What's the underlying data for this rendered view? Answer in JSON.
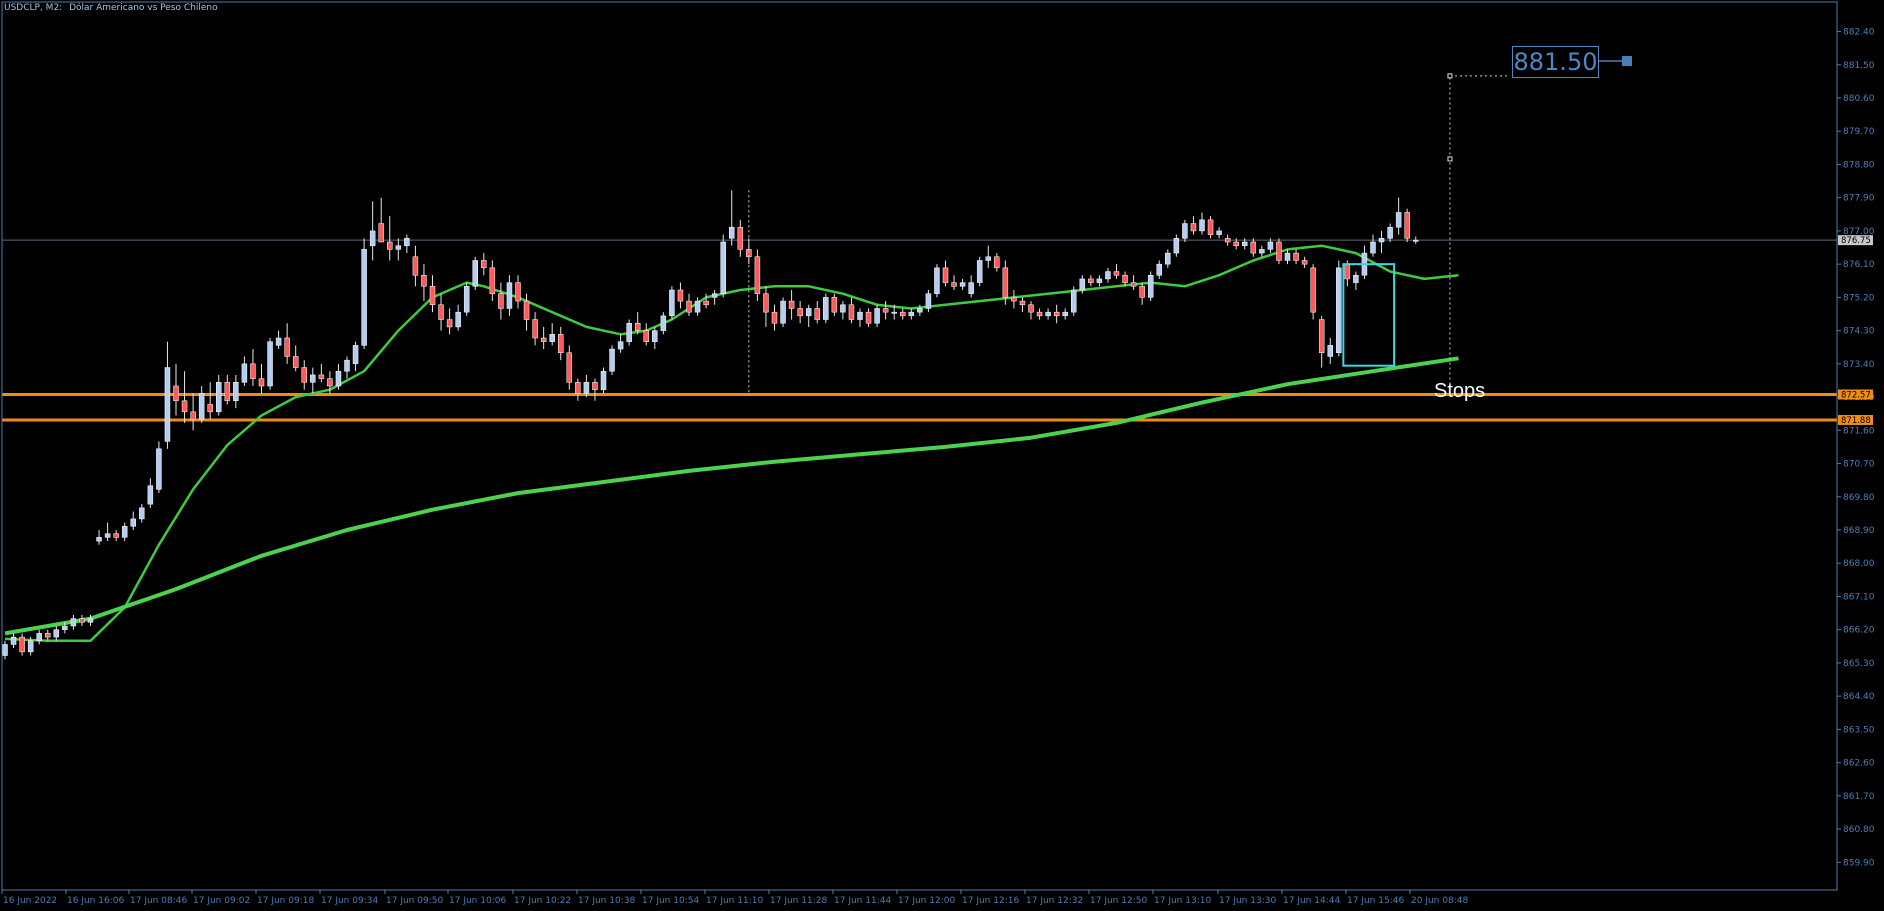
{
  "header": {
    "symbol": "USDCLP, M2:",
    "description": "Dólar Americano vs Peso Chileno"
  },
  "annotations": {
    "price_target": "881.50",
    "stops_label": "Stops"
  },
  "colors": {
    "background": "#000000",
    "axis": "#4a7db8",
    "axis_text": "#4a7db8",
    "bull_candle": "#b4cdf0",
    "bear_candle": "#ff5a5a",
    "ma_fast": "#3ecb3e",
    "ma_slow": "#4cd24c",
    "stops_line": "#f08c12",
    "box": "#3fd5e0",
    "current_price_line": "#5d6a78"
  },
  "chart_data": {
    "type": "candlestick",
    "symbol": "USDCLP",
    "timeframe": "M2",
    "ylim": [
      859.15,
      883.2
    ],
    "y_ticks": [
      "882.40",
      "881.50",
      "880.60",
      "879.70",
      "878.80",
      "877.90",
      "877.00",
      "876.10",
      "875.20",
      "874.30",
      "873.40",
      "872.50",
      "871.60",
      "870.70",
      "869.80",
      "868.90",
      "868.00",
      "867.10",
      "866.20",
      "865.30",
      "864.40",
      "863.50",
      "862.60",
      "861.70",
      "860.80",
      "859.90"
    ],
    "x_tick_labels": [
      "16 Jun 2022",
      "16 Jun 16:06",
      "17 Jun 08:46",
      "17 Jun 09:02",
      "17 Jun 09:18",
      "17 Jun 09:34",
      "17 Jun 09:50",
      "17 Jun 10:06",
      "17 Jun 10:22",
      "17 Jun 10:38",
      "17 Jun 10:54",
      "17 Jun 11:10",
      "17 Jun 11:28",
      "17 Jun 11:44",
      "17 Jun 12:00",
      "17 Jun 12:16",
      "17 Jun 12:32",
      "17 Jun 12:50",
      "17 Jun 13:10",
      "17 Jun 13:30",
      "17 Jun 14:44",
      "17 Jun 15:46",
      "20 Jun 08:48"
    ],
    "current_price": "876.75",
    "horizontal_levels": [
      {
        "label": "872.57",
        "value": 872.57
      },
      {
        "label": "871.88",
        "value": 871.88
      }
    ],
    "ohlc": [
      [
        865.5,
        865.9,
        865.4,
        865.8
      ],
      [
        865.8,
        866.1,
        865.7,
        866.0
      ],
      [
        866.0,
        866.1,
        865.5,
        865.6
      ],
      [
        865.6,
        866.0,
        865.5,
        865.9
      ],
      [
        865.9,
        866.2,
        865.8,
        866.1
      ],
      [
        866.1,
        866.2,
        865.9,
        866.0
      ],
      [
        866.0,
        866.3,
        865.9,
        866.2
      ],
      [
        866.2,
        866.4,
        866.1,
        866.3
      ],
      [
        866.3,
        866.6,
        866.2,
        866.5
      ],
      [
        866.5,
        866.6,
        866.3,
        866.4
      ],
      [
        866.4,
        866.6,
        866.3,
        866.5
      ],
      [
        868.6,
        868.9,
        868.5,
        868.7
      ],
      [
        868.7,
        869.1,
        868.6,
        868.8
      ],
      [
        868.8,
        868.9,
        868.6,
        868.7
      ],
      [
        868.7,
        869.1,
        868.6,
        869.0
      ],
      [
        869.0,
        869.4,
        868.9,
        869.2
      ],
      [
        869.2,
        869.6,
        869.1,
        869.5
      ],
      [
        869.6,
        870.3,
        869.5,
        870.1
      ],
      [
        870.0,
        871.3,
        869.9,
        871.1
      ],
      [
        871.3,
        874.0,
        871.1,
        873.3
      ],
      [
        872.8,
        873.4,
        872.0,
        872.4
      ],
      [
        872.4,
        873.2,
        871.8,
        872.1
      ],
      [
        872.1,
        872.6,
        871.6,
        871.9
      ],
      [
        871.9,
        872.8,
        871.8,
        872.6
      ],
      [
        872.3,
        872.9,
        871.9,
        872.1
      ],
      [
        872.1,
        873.1,
        872.0,
        872.9
      ],
      [
        872.9,
        873.1,
        872.3,
        872.4
      ],
      [
        872.4,
        873.1,
        872.2,
        872.9
      ],
      [
        872.9,
        873.6,
        872.8,
        873.4
      ],
      [
        873.4,
        873.8,
        872.8,
        873.0
      ],
      [
        873.0,
        873.4,
        872.6,
        872.8
      ],
      [
        872.8,
        874.1,
        872.7,
        874.0
      ],
      [
        873.9,
        874.3,
        873.8,
        874.1
      ],
      [
        874.1,
        874.5,
        873.4,
        873.6
      ],
      [
        873.6,
        873.9,
        873.2,
        873.3
      ],
      [
        873.3,
        873.5,
        872.7,
        872.9
      ],
      [
        872.9,
        873.3,
        872.6,
        873.1
      ],
      [
        873.1,
        873.4,
        872.9,
        873.0
      ],
      [
        873.0,
        873.2,
        872.6,
        872.8
      ],
      [
        872.8,
        873.4,
        872.7,
        873.2
      ],
      [
        873.2,
        873.6,
        873.0,
        873.5
      ],
      [
        873.4,
        874.0,
        873.2,
        873.9
      ],
      [
        873.9,
        876.8,
        873.8,
        876.5
      ],
      [
        876.6,
        877.8,
        876.2,
        877.0
      ],
      [
        877.2,
        877.9,
        876.8,
        876.7
      ],
      [
        876.7,
        877.4,
        876.2,
        876.5
      ],
      [
        876.5,
        876.8,
        876.2,
        876.6
      ],
      [
        876.6,
        876.9,
        876.4,
        876.8
      ],
      [
        876.3,
        876.6,
        875.5,
        875.8
      ],
      [
        875.8,
        876.1,
        875.1,
        875.5
      ],
      [
        875.5,
        875.8,
        874.8,
        875.0
      ],
      [
        875.0,
        875.3,
        874.3,
        874.6
      ],
      [
        874.6,
        874.9,
        874.2,
        874.4
      ],
      [
        874.4,
        875.0,
        874.3,
        874.8
      ],
      [
        874.8,
        875.6,
        874.7,
        875.5
      ],
      [
        875.5,
        876.3,
        875.4,
        876.2
      ],
      [
        876.2,
        876.4,
        875.8,
        876.0
      ],
      [
        876.0,
        876.2,
        875.1,
        875.3
      ],
      [
        875.3,
        875.6,
        874.6,
        874.9
      ],
      [
        874.9,
        875.8,
        874.7,
        875.6
      ],
      [
        875.6,
        875.8,
        874.9,
        875.1
      ],
      [
        875.1,
        875.3,
        874.3,
        874.6
      ],
      [
        874.6,
        874.8,
        873.9,
        874.1
      ],
      [
        874.1,
        874.4,
        873.8,
        874.0
      ],
      [
        874.0,
        874.5,
        873.9,
        874.2
      ],
      [
        874.2,
        874.4,
        873.5,
        873.7
      ],
      [
        873.7,
        873.9,
        872.7,
        872.9
      ],
      [
        872.9,
        873.0,
        872.4,
        872.6
      ],
      [
        872.6,
        873.1,
        872.5,
        872.9
      ],
      [
        872.9,
        873.0,
        872.4,
        872.7
      ],
      [
        872.7,
        873.3,
        872.6,
        873.2
      ],
      [
        873.2,
        873.9,
        873.1,
        873.8
      ],
      [
        873.8,
        874.2,
        873.7,
        874.0
      ],
      [
        874.0,
        874.6,
        873.9,
        874.5
      ],
      [
        874.5,
        874.8,
        874.2,
        874.3
      ],
      [
        874.3,
        874.5,
        873.9,
        874.0
      ],
      [
        874.0,
        874.4,
        873.8,
        874.3
      ],
      [
        874.3,
        874.8,
        874.2,
        874.7
      ],
      [
        874.7,
        875.5,
        874.6,
        875.4
      ],
      [
        875.4,
        875.6,
        874.9,
        875.1
      ],
      [
        875.1,
        875.3,
        874.7,
        874.8
      ],
      [
        874.8,
        875.2,
        874.7,
        875.1
      ],
      [
        875.1,
        875.3,
        874.9,
        875.0
      ],
      [
        875.2,
        875.4,
        875.0,
        875.3
      ],
      [
        875.3,
        876.9,
        875.2,
        876.7
      ],
      [
        876.8,
        878.1,
        876.6,
        877.1
      ],
      [
        877.1,
        877.3,
        876.3,
        876.5
      ],
      [
        876.5,
        876.8,
        876.1,
        876.3
      ],
      [
        876.3,
        876.5,
        875.1,
        875.3
      ],
      [
        875.3,
        875.5,
        874.4,
        874.8
      ],
      [
        874.8,
        875.0,
        874.3,
        874.5
      ],
      [
        874.5,
        875.2,
        874.4,
        875.1
      ],
      [
        875.1,
        875.4,
        874.6,
        874.9
      ],
      [
        874.9,
        875.1,
        874.5,
        874.7
      ],
      [
        874.7,
        875.0,
        874.4,
        874.9
      ],
      [
        874.9,
        875.1,
        874.5,
        874.6
      ],
      [
        874.6,
        875.3,
        874.5,
        875.2
      ],
      [
        875.2,
        875.3,
        874.7,
        874.8
      ],
      [
        874.8,
        875.1,
        874.6,
        875.0
      ],
      [
        875.0,
        875.2,
        874.5,
        874.6
      ],
      [
        874.6,
        874.9,
        874.4,
        874.8
      ],
      [
        874.8,
        874.9,
        874.4,
        874.5
      ],
      [
        874.5,
        875.0,
        874.4,
        874.9
      ],
      [
        874.9,
        875.1,
        874.6,
        874.8
      ],
      [
        874.8,
        875.0,
        874.6,
        874.8
      ],
      [
        874.8,
        874.9,
        874.6,
        874.7
      ],
      [
        874.7,
        874.9,
        874.6,
        874.8
      ],
      [
        874.8,
        875.0,
        874.7,
        874.9
      ],
      [
        874.9,
        875.4,
        874.8,
        875.3
      ],
      [
        875.3,
        876.1,
        875.2,
        876.0
      ],
      [
        876.0,
        876.2,
        875.5,
        875.6
      ],
      [
        875.6,
        875.8,
        875.4,
        875.5
      ],
      [
        875.5,
        875.7,
        875.4,
        875.6
      ],
      [
        875.3,
        875.8,
        875.2,
        875.6
      ],
      [
        875.6,
        876.3,
        875.5,
        876.2
      ],
      [
        876.2,
        876.6,
        876.0,
        876.3
      ],
      [
        876.3,
        876.4,
        875.9,
        876.0
      ],
      [
        876.0,
        876.2,
        875.0,
        875.2
      ],
      [
        875.2,
        875.4,
        874.9,
        875.1
      ],
      [
        875.1,
        875.2,
        874.8,
        875.0
      ],
      [
        875.0,
        875.1,
        874.6,
        874.8
      ],
      [
        874.8,
        874.9,
        874.6,
        874.7
      ],
      [
        874.7,
        874.9,
        874.6,
        874.8
      ],
      [
        874.8,
        875.0,
        874.5,
        874.7
      ],
      [
        874.7,
        874.9,
        874.6,
        874.8
      ],
      [
        874.8,
        875.5,
        874.7,
        875.4
      ],
      [
        875.4,
        875.8,
        875.3,
        875.7
      ],
      [
        875.7,
        875.8,
        875.5,
        875.6
      ],
      [
        875.6,
        875.8,
        875.5,
        875.7
      ],
      [
        875.7,
        876.0,
        875.6,
        875.9
      ],
      [
        875.9,
        876.1,
        875.7,
        875.8
      ],
      [
        875.8,
        875.9,
        875.5,
        875.6
      ],
      [
        875.6,
        875.8,
        875.4,
        875.5
      ],
      [
        875.5,
        875.6,
        875.0,
        875.2
      ],
      [
        875.2,
        875.9,
        875.1,
        875.8
      ],
      [
        875.8,
        876.2,
        875.7,
        876.1
      ],
      [
        876.1,
        876.5,
        876.0,
        876.4
      ],
      [
        876.4,
        876.9,
        876.3,
        876.8
      ],
      [
        876.8,
        877.3,
        876.7,
        877.2
      ],
      [
        877.2,
        877.4,
        876.9,
        877.0
      ],
      [
        877.0,
        877.5,
        876.9,
        877.3
      ],
      [
        877.3,
        877.4,
        876.8,
        876.9
      ],
      [
        876.9,
        877.1,
        876.8,
        877.0
      ],
      [
        876.8,
        876.9,
        876.6,
        876.7
      ],
      [
        876.7,
        876.8,
        876.5,
        876.6
      ],
      [
        876.6,
        876.8,
        876.5,
        876.7
      ],
      [
        876.7,
        876.8,
        876.3,
        876.4
      ],
      [
        876.4,
        876.6,
        876.3,
        876.5
      ],
      [
        876.5,
        876.8,
        876.4,
        876.7
      ],
      [
        876.7,
        876.8,
        876.1,
        876.2
      ],
      [
        876.2,
        876.5,
        876.1,
        876.4
      ],
      [
        876.4,
        876.5,
        876.1,
        876.2
      ],
      [
        876.2,
        876.3,
        876.0,
        876.1
      ],
      [
        876.0,
        876.1,
        874.6,
        874.8
      ],
      [
        874.6,
        874.7,
        873.3,
        873.7
      ],
      [
        873.6,
        874.1,
        873.4,
        873.9
      ],
      [
        873.7,
        876.2,
        873.6,
        876.0
      ],
      [
        876.1,
        876.2,
        875.5,
        875.7
      ],
      [
        875.6,
        875.9,
        875.4,
        875.8
      ],
      [
        875.8,
        876.6,
        875.7,
        876.4
      ],
      [
        876.4,
        876.9,
        876.3,
        876.7
      ],
      [
        876.7,
        877.0,
        876.4,
        876.8
      ],
      [
        876.8,
        877.2,
        876.7,
        877.1
      ],
      [
        877.1,
        877.9,
        876.9,
        877.5
      ],
      [
        877.5,
        877.6,
        876.7,
        876.8
      ],
      [
        876.75,
        876.85,
        876.65,
        876.75
      ]
    ],
    "moving_averages": [
      {
        "role": "fast",
        "points": [
          [
            0,
            865.95
          ],
          [
            5,
            865.9
          ],
          [
            10,
            865.9
          ],
          [
            14,
            866.8
          ],
          [
            18,
            868.5
          ],
          [
            22,
            870.0
          ],
          [
            26,
            871.2
          ],
          [
            30,
            872.0
          ],
          [
            34,
            872.5
          ],
          [
            38,
            872.7
          ],
          [
            42,
            873.2
          ],
          [
            46,
            874.3
          ],
          [
            50,
            875.2
          ],
          [
            54,
            875.6
          ],
          [
            56,
            875.5
          ],
          [
            60,
            875.2
          ],
          [
            64,
            874.8
          ],
          [
            68,
            874.4
          ],
          [
            72,
            874.2
          ],
          [
            75,
            874.3
          ],
          [
            78,
            874.6
          ],
          [
            82,
            875.2
          ],
          [
            86,
            875.4
          ],
          [
            90,
            875.5
          ],
          [
            94,
            875.5
          ],
          [
            98,
            875.3
          ],
          [
            102,
            875.0
          ],
          [
            106,
            874.9
          ],
          [
            110,
            875.0
          ],
          [
            114,
            875.1
          ],
          [
            118,
            875.2
          ],
          [
            122,
            875.3
          ],
          [
            126,
            875.4
          ],
          [
            130,
            875.5
          ],
          [
            134,
            875.6
          ],
          [
            138,
            875.5
          ],
          [
            142,
            875.8
          ],
          [
            146,
            876.2
          ],
          [
            150,
            876.5
          ],
          [
            154,
            876.6
          ],
          [
            158,
            876.4
          ],
          [
            162,
            875.9
          ],
          [
            166,
            875.7
          ],
          [
            170,
            875.8
          ]
        ]
      },
      {
        "role": "slow",
        "points": [
          [
            0,
            866.1
          ],
          [
            10,
            866.5
          ],
          [
            20,
            867.3
          ],
          [
            30,
            868.2
          ],
          [
            40,
            868.9
          ],
          [
            50,
            869.45
          ],
          [
            60,
            869.9
          ],
          [
            70,
            870.2
          ],
          [
            80,
            870.5
          ],
          [
            90,
            870.75
          ],
          [
            100,
            870.95
          ],
          [
            110,
            871.15
          ],
          [
            120,
            871.4
          ],
          [
            130,
            871.8
          ],
          [
            140,
            872.35
          ],
          [
            150,
            872.85
          ],
          [
            160,
            873.2
          ],
          [
            170,
            873.55
          ]
        ]
      }
    ],
    "highlight_box": {
      "from_index": 157,
      "to_index": 162,
      "low": 873.35,
      "high": 876.1
    },
    "price_projection": {
      "bar_index": 169,
      "from": 872.57,
      "to": 881.2,
      "marker_values": [
        878.95,
        881.2
      ]
    }
  }
}
